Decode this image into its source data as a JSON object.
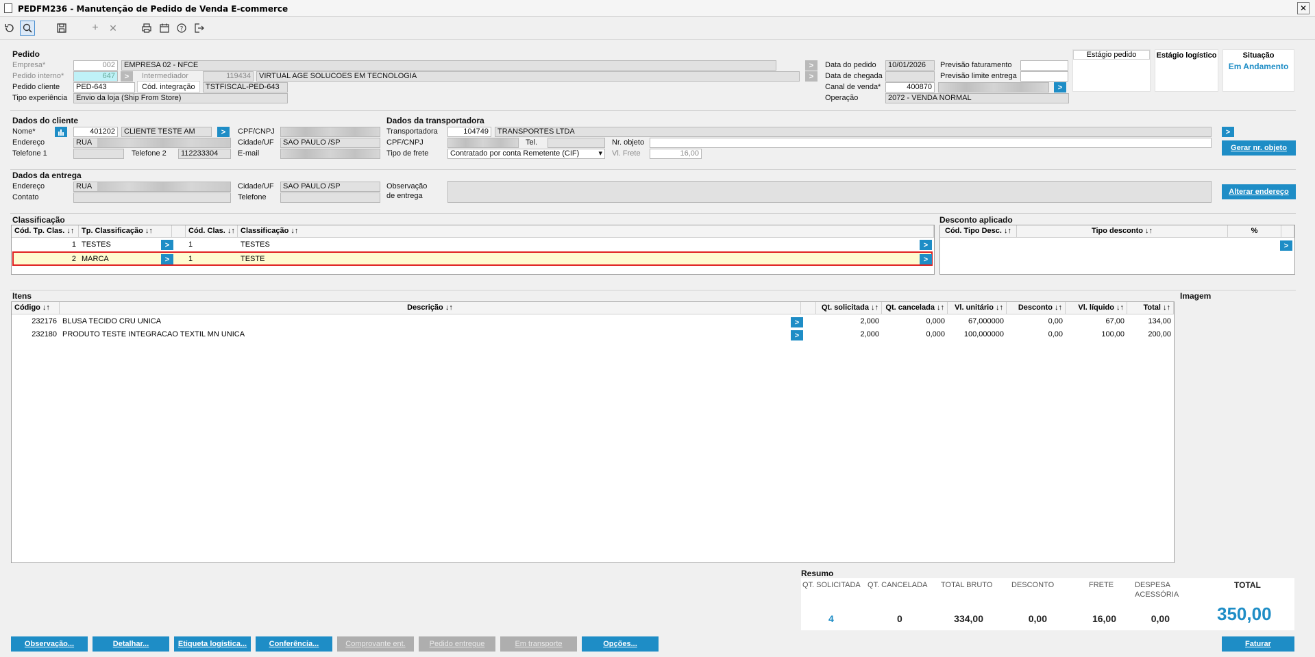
{
  "window": {
    "title": "PEDFM236 - Manutenção de Pedido de Venda E-commerce",
    "close": "✕"
  },
  "pedido": {
    "section": "Pedido",
    "empresa_label": "Empresa*",
    "empresa_code": "002",
    "empresa_name": "EMPRESA 02 - NFCE",
    "pedido_interno_label": "Pedido interno*",
    "pedido_interno": "647",
    "intermediador_label": "Intermediador",
    "intermediador_code": "119434",
    "intermediador_name": "VIRTUAL AGE SOLUCOES EM TECNOLOGIA",
    "pedido_cliente_label": "Pedido cliente",
    "pedido_cliente": "PED-643",
    "cod_integracao_label": "Cód. integração",
    "cod_integracao": "TSTFISCAL-PED-643",
    "tipo_experiencia_label": "Tipo experiência",
    "tipo_experiencia": "Envio da loja (Ship From Store)",
    "data_pedido_label": "Data do pedido",
    "data_pedido": "10/01/2026",
    "data_chegada_label": "Data de chegada",
    "data_chegada": "",
    "canal_venda_label": "Canal de venda*",
    "canal_venda_code": "400870",
    "operacao_label": "Operação",
    "operacao": "2072 - VENDA NORMAL",
    "prev_faturamento_label": "Previsão faturamento",
    "prev_faturamento": "",
    "prev_limite_label": "Previsão limite entrega",
    "prev_limite": ""
  },
  "stages": {
    "estagio_pedido": "Estágio pedido",
    "estagio_logistico": "Estágio logístico",
    "situacao_label": "Situação",
    "situacao_value": "Em Andamento"
  },
  "cliente": {
    "section": "Dados do cliente",
    "nome_label": "Nome*",
    "nome_code": "401202",
    "nome": "CLIENTE TESTE AM",
    "endereco_label": "Endereço",
    "endereco": "RUA",
    "telefone1_label": "Telefone 1",
    "telefone1": "",
    "telefone2_label": "Telefone 2",
    "telefone2": "112233304",
    "cpf_label": "CPF/CNPJ",
    "cidade_label": "Cidade/UF",
    "cidade": "SAO PAULO /SP",
    "email_label": "E-mail"
  },
  "transportadora": {
    "section": "Dados da transportadora",
    "transp_label": "Transportadora",
    "transp_code": "104749",
    "transp_name": "TRANSPORTES LTDA",
    "cpf_label": "CPF/CNPJ",
    "tel_label": "Tel.",
    "nr_objeto_label": "Nr. objeto",
    "tipo_frete_label": "Tipo de frete",
    "tipo_frete": "Contratado por conta Remetente (CIF)",
    "vl_frete_label": "Vl. Frete",
    "vl_frete": "16,00",
    "gerar_button": "Gerar nr. objeto"
  },
  "entrega": {
    "section": "Dados da entrega",
    "endereco_label": "Endereço",
    "endereco": "RUA",
    "contato_label": "Contato",
    "cidade_label": "Cidade/UF",
    "cidade": "SAO PAULO /SP",
    "telefone_label": "Telefone",
    "obs_label1": "Observação",
    "obs_label2": "de entrega",
    "alterar_button": "Alterar endereço"
  },
  "classificacao": {
    "section": "Classificação",
    "headers": [
      "Cód. Tp. Clas. ↓↑",
      "Tp. Classificação ↓↑",
      "Cód. Clas. ↓↑",
      "Classificação ↓↑"
    ],
    "rows": [
      {
        "cod_tp": "1",
        "tp": "TESTES",
        "cod": "1",
        "clas": "TESTES"
      },
      {
        "cod_tp": "2",
        "tp": "MARCA",
        "cod": "1",
        "clas": "TESTE"
      }
    ]
  },
  "desconto": {
    "section": "Desconto aplicado",
    "headers": [
      "Cód. Tipo Desc. ↓↑",
      "Tipo desconto ↓↑",
      "%"
    ]
  },
  "itens": {
    "section": "Itens",
    "imagem_label": "Imagem",
    "headers": [
      "Código ↓↑",
      "Descrição ↓↑",
      "Qt. solicitada ↓↑",
      "Qt. cancelada ↓↑",
      "Vl. unitário ↓↑",
      "Desconto ↓↑",
      "Vl. líquido ↓↑",
      "Total ↓↑"
    ],
    "rows": [
      {
        "codigo": "232176",
        "descricao": "BLUSA TECIDO CRU UNICA",
        "qt_sol": "2,000",
        "qt_can": "0,000",
        "vl_unit": "67,000000",
        "desconto": "0,00",
        "vl_liq": "67,00",
        "total": "134,00"
      },
      {
        "codigo": "232180",
        "descricao": "PRODUTO TESTE INTEGRACAO TEXTIL MN UNICA",
        "qt_sol": "2,000",
        "qt_can": "0,000",
        "vl_unit": "100,000000",
        "desconto": "0,00",
        "vl_liq": "100,00",
        "total": "200,00"
      }
    ]
  },
  "resumo": {
    "section": "Resumo",
    "labels": [
      "QT. SOLICITADA",
      "QT. CANCELADA",
      "TOTAL BRUTO",
      "DESCONTO",
      "FRETE",
      "DESPESA ACESSÓRIA",
      "TOTAL"
    ],
    "values": [
      "4",
      "0",
      "334,00",
      "0,00",
      "16,00",
      "0,00",
      "350,00"
    ]
  },
  "buttons": {
    "observacao": "Observação...",
    "detalhar": "Detalhar...",
    "etiqueta": "Etiqueta logística...",
    "conferencia": "Conferência...",
    "comprovante": "Comprovante ent.",
    "pedido_entregue": "Pedido entregue",
    "em_transporte": "Em transporte",
    "opcoes": "Opções...",
    "faturar": "Faturar"
  },
  "colors": {
    "accent": "#1e8dc6",
    "disabled": "#aeaeae",
    "highlight_row": "#fffbd0",
    "highlight_border": "#e02020",
    "situacao": "#1e8dc6"
  }
}
